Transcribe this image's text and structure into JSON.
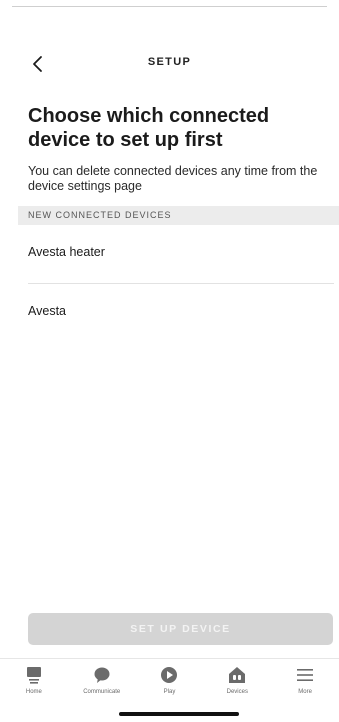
{
  "header": {
    "title": "SETUP",
    "back_icon": "chevron-left-icon"
  },
  "main": {
    "title": "Choose which connected device to set up first",
    "subtitle": "You can delete connected devices any time from the device settings page",
    "section_header": "NEW CONNECTED DEVICES",
    "devices": [
      {
        "label": "Avesta heater"
      },
      {
        "label": "Avesta"
      }
    ],
    "setup_button": {
      "label": "SET UP DEVICE",
      "enabled": false
    }
  },
  "tabbar": {
    "items": [
      {
        "label": "Home",
        "icon": "home-icon"
      },
      {
        "label": "Communicate",
        "icon": "communicate-icon"
      },
      {
        "label": "Play",
        "icon": "play-icon"
      },
      {
        "label": "Devices",
        "icon": "devices-icon"
      },
      {
        "label": "More",
        "icon": "menu-icon"
      }
    ]
  },
  "colors": {
    "icon": "#6b6b6b",
    "disabled_button": "#d4d4d4",
    "section_bg": "#ececec"
  }
}
